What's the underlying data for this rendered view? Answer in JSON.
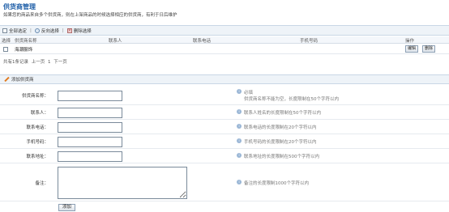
{
  "page": {
    "title": "供货商管理",
    "subtitle": "如果您的商品来自多个供货商，则在上架商品的时候选择相应的供货商，有利于日后维护"
  },
  "toolbar": {
    "select_all": "全部选定",
    "separator": "|",
    "invert": "反向选择",
    "delete": "删除选择"
  },
  "table": {
    "headers": [
      "选择",
      "供货商名称",
      "联系人",
      "联系电话",
      "手机号码",
      "操作"
    ],
    "rows": [
      {
        "name": "海潮服饰",
        "edit": "编辑",
        "delete": "删除"
      }
    ]
  },
  "pager": {
    "summary": "共有1条记录",
    "prev": "上一页",
    "page": "1",
    "next": "下一页"
  },
  "form": {
    "section_title": "添加供货商",
    "fields": [
      {
        "label": "供货商名称：",
        "hint_line1": "必填",
        "hint_line2": "供货商名称不能为空，长度限制在50个字符以内"
      },
      {
        "label": "联系人：",
        "hint_line1": "联系人姓名的长度限制在50个字符以内"
      },
      {
        "label": "联系电话：",
        "hint_line1": "联系电话的长度限制在20个字符以内"
      },
      {
        "label": "手机号码：",
        "hint_line1": "手机号码的长度限制在20个字符以内"
      },
      {
        "label": "联系地址：",
        "hint_line1": "联系地址的长度限制在500个字符以内"
      },
      {
        "label": "备注：",
        "hint_line1": "备注的长度限制1000个字符以内"
      }
    ],
    "submit": "添加"
  },
  "icons": {
    "hint": "info-icon",
    "section": "pencil-icon",
    "invert": "circle-icon",
    "delete": "x-icon"
  }
}
